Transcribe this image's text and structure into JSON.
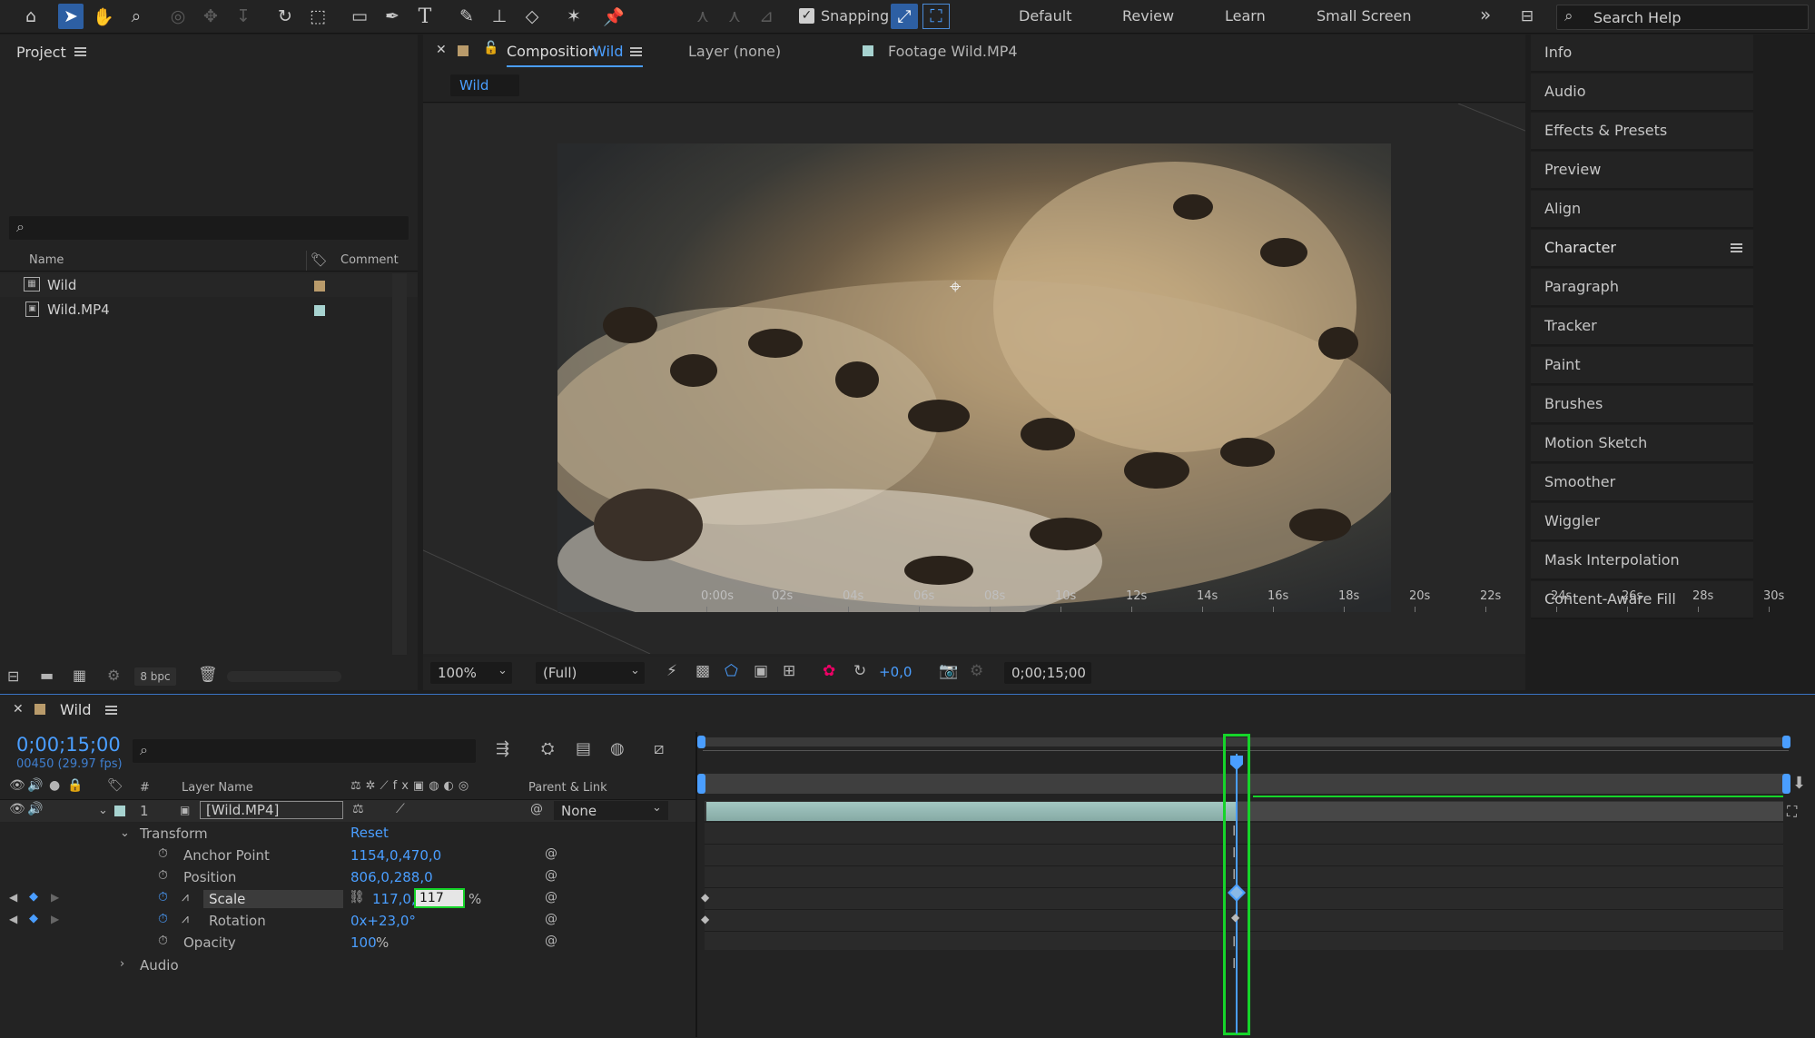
{
  "toolbar": {
    "snapping_label": "Snapping",
    "workspaces": [
      "Default",
      "Review",
      "Learn",
      "Small Screen"
    ],
    "more": "»",
    "search_placeholder": "Search Help"
  },
  "project": {
    "title": "Project",
    "col_name": "Name",
    "col_comment": "Comment",
    "items": [
      {
        "name": "Wild",
        "label_color": "#b99b6b"
      },
      {
        "name": "Wild.MP4",
        "label_color": "#a7d3d0"
      }
    ],
    "bpc": "8 bpc"
  },
  "comp_viewer": {
    "tab_comp_prefix": "Composition",
    "tab_comp_name": "Wild",
    "tab_layer": "Layer (none)",
    "tab_footage": "Footage Wild.MP4",
    "sub_tab": "Wild",
    "zoom": "100%",
    "resolution": "(Full)",
    "exposure": "+0,0",
    "timecode": "0;00;15;00"
  },
  "right_panels": [
    "Info",
    "Audio",
    "Effects & Presets",
    "Preview",
    "Align",
    "Character",
    "Paragraph",
    "Tracker",
    "Paint",
    "Brushes",
    "Motion Sketch",
    "Smoother",
    "Wiggler",
    "Mask Interpolation",
    "Content-Aware Fill"
  ],
  "timeline": {
    "tab": "Wild",
    "current_time": "0;00;15;00",
    "frames_fps": "00450 (29.97 fps)",
    "col_hash": "#",
    "col_layer_name": "Layer Name",
    "col_parent": "Parent & Link",
    "layer": {
      "index": "1",
      "name": "[Wild.MP4]",
      "parent": "None"
    },
    "transform_label": "Transform",
    "reset_label": "Reset",
    "props": [
      {
        "name": "Anchor Point",
        "value": "1154,0,470,0"
      },
      {
        "name": "Position",
        "value": "806,0,288,0"
      },
      {
        "name": "Scale",
        "value": "117,0,",
        "edit": "117",
        "unit": "%"
      },
      {
        "name": "Rotation",
        "value": "0x+23,0°"
      },
      {
        "name": "Opacity",
        "value": "100",
        "unit": "%"
      }
    ],
    "audio_label": "Audio",
    "ruler": [
      "0:00s",
      "02s",
      "04s",
      "06s",
      "08s",
      "10s",
      "12s",
      "14s",
      "16s",
      "18s",
      "20s",
      "22s",
      "24s",
      "26s",
      "28s",
      "30s"
    ]
  }
}
